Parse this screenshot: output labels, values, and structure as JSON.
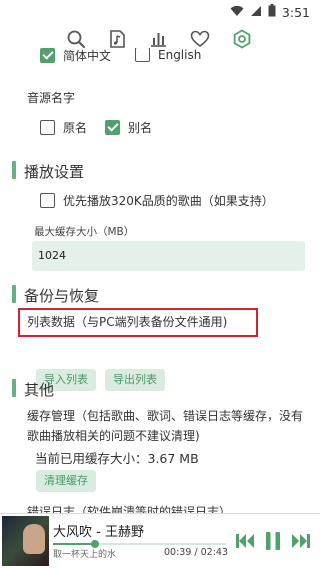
{
  "status_bar": {
    "time": "3:51"
  },
  "toolbar": {
    "icons": [
      "search-icon",
      "music-import-icon",
      "chart-icon",
      "heart-icon",
      "settings-icon"
    ],
    "active": "settings-icon"
  },
  "language": {
    "option1": {
      "label": "简体中文",
      "checked": true
    },
    "option2": {
      "label": "English",
      "checked": false
    }
  },
  "source_name": {
    "label": "音源名字",
    "option1": {
      "label": "原名",
      "checked": false
    },
    "option2": {
      "label": "别名",
      "checked": true
    }
  },
  "playback": {
    "title": "播放设置",
    "option_320k": {
      "label": "优先播放320K品质的歌曲（如果支持）",
      "checked": false
    },
    "max_cache_label": "最大缓存大小（MB）",
    "max_cache_value": "1024"
  },
  "backup": {
    "title": "备份与恢复",
    "list_data_label": "列表数据（与PC端列表备份文件通用)",
    "import_button": "导入列表",
    "export_button": "导出列表"
  },
  "other": {
    "title": "其他",
    "cache_desc": "缓存管理（包括歌曲、歌词、错误日志等缓存，没有歌曲播放相关的问题不建议清理)",
    "cache_used": "当前已用缓存大小：3.67 MB",
    "clear_cache_button": "清理缓存",
    "partial_text": "错误日志（软件崩溃等时的错误日志）"
  },
  "player": {
    "song_title": "大风吹 - 王赫野",
    "subtitle": "取一杯天上的水",
    "current_time": "00:39",
    "total_time": "02:43",
    "progress": 0.24,
    "accent_color": "#52a06b"
  }
}
